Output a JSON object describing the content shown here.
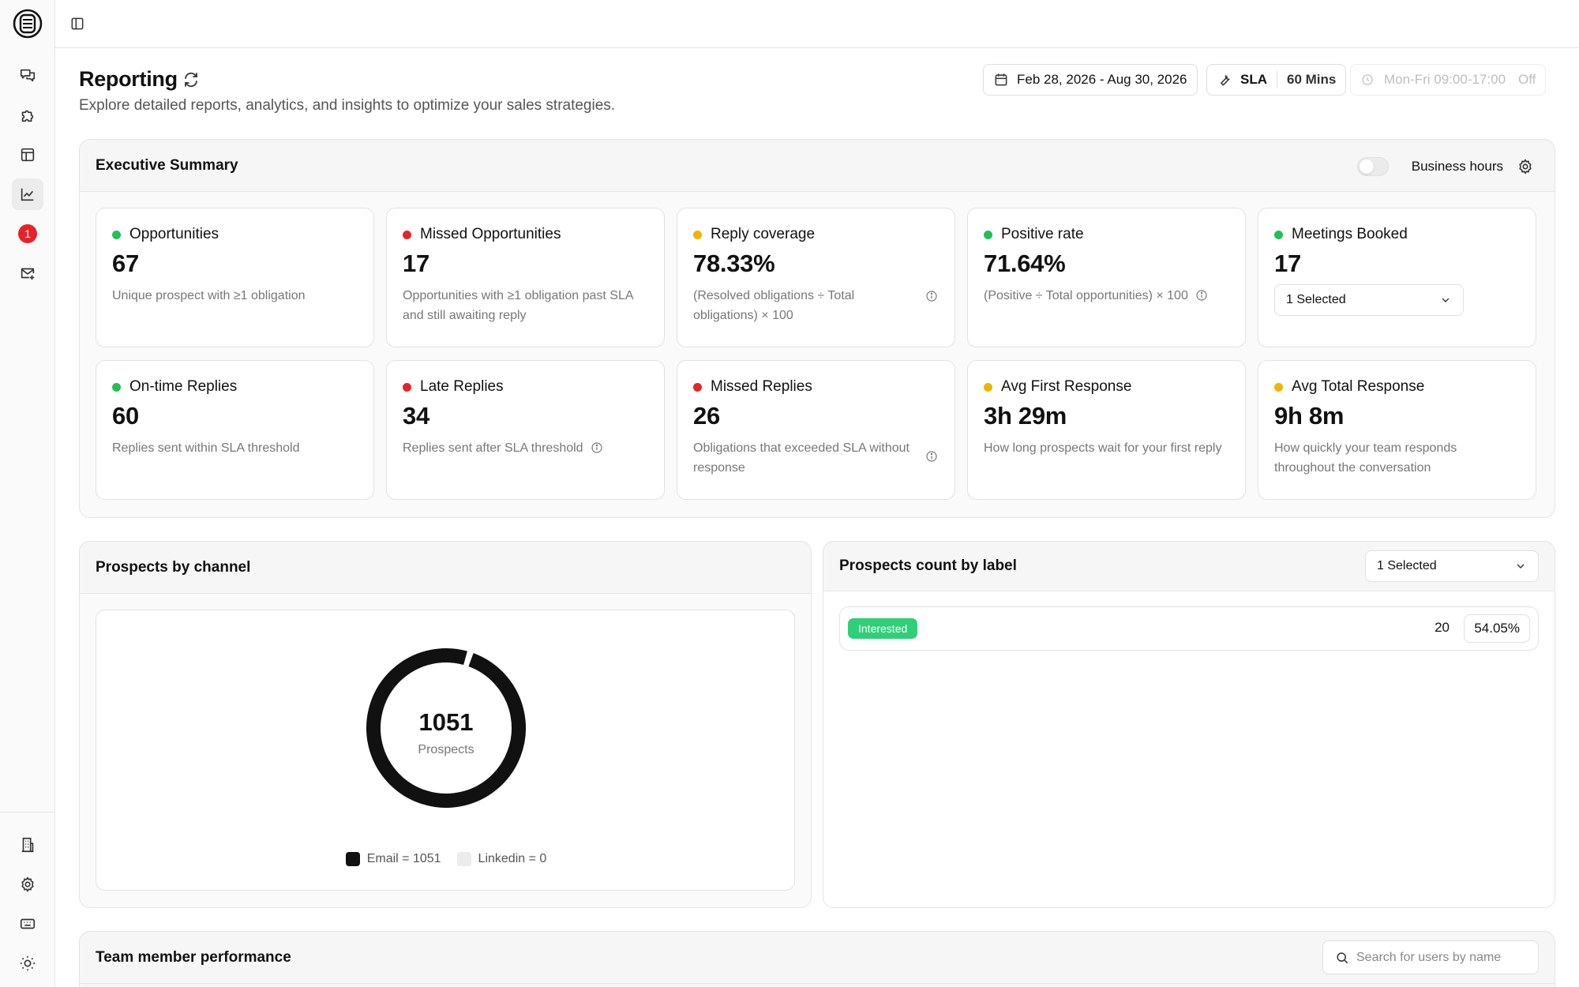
{
  "sidebar": {
    "items": [
      {
        "icon": "chat-icon"
      },
      {
        "icon": "puzzle-icon"
      },
      {
        "icon": "table-icon"
      },
      {
        "icon": "chart-icon",
        "active": true
      },
      {
        "icon": "notification-badge",
        "badge": "1"
      },
      {
        "icon": "mail-add-icon"
      }
    ],
    "bottom_items": [
      {
        "icon": "building-icon"
      },
      {
        "icon": "gear-icon"
      },
      {
        "icon": "keyboard-icon"
      },
      {
        "icon": "sun-icon"
      }
    ],
    "badge": "1"
  },
  "header": {
    "title": "Reporting",
    "subtitle": "Explore detailed reports, analytics, and insights to optimize your sales strategies.",
    "date_range": "Feb 28, 2026 - Aug 30, 2026",
    "sla_label": "SLA",
    "sla_value": "60 Mins",
    "hours_label": "Mon-Fri 09:00-17:00",
    "hours_state": "Off"
  },
  "executive_summary": {
    "title": "Executive Summary",
    "business_hours_label": "Business hours",
    "metrics": [
      {
        "title": "Opportunities",
        "value": "67",
        "desc": "Unique prospect with ≥1 obligation",
        "status": "green"
      },
      {
        "title": "Missed Opportunities",
        "value": "17",
        "desc": "Opportunities with ≥1 obligation past SLA and still awaiting reply",
        "status": "red"
      },
      {
        "title": "Reply coverage",
        "value": "78.33%",
        "desc": "(Resolved obligations ÷ Total obligations) × 100",
        "status": "yellow",
        "info": true
      },
      {
        "title": "Positive rate",
        "value": "71.64%",
        "desc": "(Positive ÷ Total opportunities) × 100",
        "status": "green",
        "info": true
      },
      {
        "title": "Meetings Booked",
        "value": "17",
        "select": "1 Selected",
        "status": "green"
      },
      {
        "title": "On-time Replies",
        "value": "60",
        "desc": "Replies sent within SLA threshold",
        "status": "green"
      },
      {
        "title": "Late Replies",
        "value": "34",
        "desc": "Replies sent after SLA threshold",
        "status": "red",
        "info": true
      },
      {
        "title": "Missed Replies",
        "value": "26",
        "desc": "Obligations that exceeded SLA without response",
        "status": "red",
        "info": true
      },
      {
        "title": "Avg First Response",
        "value": "3h 29m",
        "desc": "How long prospects wait for your first reply",
        "status": "yellow"
      },
      {
        "title": "Avg Total Response",
        "value": "9h 8m",
        "desc": "How quickly your team responds throughout the conversation",
        "status": "yellow"
      }
    ]
  },
  "colors": {
    "green": "#1ec255",
    "red": "#e5242a",
    "yellow": "#f0b400",
    "donut": "#111111",
    "tag_green": "#2fcf78"
  },
  "prospects_by_channel": {
    "title": "Prospects by channel",
    "total": "1051",
    "total_label": "Prospects",
    "legend": [
      "Email = 1051",
      "Linkedin = 0"
    ]
  },
  "chart_data": {
    "type": "pie",
    "categories": [
      "Email",
      "Linkedin"
    ],
    "values": [
      1051,
      0
    ],
    "title": "Prospects by channel"
  },
  "prospects_by_label": {
    "title": "Prospects count by label",
    "select": "1 Selected",
    "rows": [
      {
        "label": "Interested",
        "count": "20",
        "percent": "54.05%"
      }
    ]
  },
  "team_performance": {
    "title": "Team member performance",
    "search_placeholder": "Search for users by name"
  }
}
